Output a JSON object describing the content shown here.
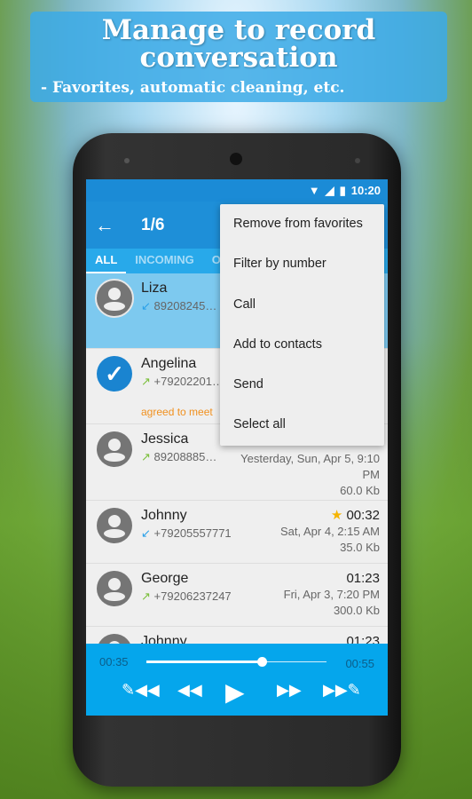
{
  "banner": {
    "title": "Manage to record conversation",
    "subtitle": "- Favorites, automatic cleaning, etc."
  },
  "status": {
    "time": "10:20",
    "icons": [
      "wifi-icon",
      "signal-icon",
      "battery-charging-icon"
    ]
  },
  "toolbar": {
    "back_icon": "arrow-left-icon",
    "title": "1/6"
  },
  "tabs": [
    {
      "label": "ALL",
      "active": true
    },
    {
      "label": "INCOMING",
      "active": false
    },
    {
      "label": "O",
      "active": false
    }
  ],
  "records": [
    {
      "name": "Liza",
      "direction": "incoming",
      "number": "89208245…",
      "selected": true
    },
    {
      "name": "Angelina",
      "direction": "outgoing",
      "number": "+79202201…",
      "checked": true,
      "note": "agreed to meet"
    },
    {
      "name": "Jessica",
      "direction": "outgoing",
      "number": "89208885…",
      "date": "Yesterday, Sun, Apr 5, 9:10 PM",
      "size": "60.0 Kb"
    },
    {
      "name": "Johnny",
      "direction": "incoming",
      "number": "+79205557771",
      "favorite": true,
      "duration": "00:32",
      "date": "Sat, Apr 4, 2:15 AM",
      "size": "35.0 Kb"
    },
    {
      "name": "George",
      "direction": "outgoing",
      "number": "+79206237247",
      "duration": "01:23",
      "date": "Fri, Apr 3, 7:20 PM",
      "size": "300.0 Kb"
    },
    {
      "name": "Johnny",
      "duration": "01:23"
    }
  ],
  "player": {
    "elapsed": "00:35",
    "total": "00:55",
    "progress": 0.64,
    "colors": {
      "bar": "#05a6ec"
    }
  },
  "menu": [
    "Remove from favorites",
    "Filter by number",
    "Call",
    "Add to contacts",
    "Send",
    "Select all"
  ],
  "colors": {
    "accent": "#1e8fd8",
    "selected_row": "#7dc9ef",
    "note": "#f0901e",
    "favorite": "#f5b400"
  }
}
